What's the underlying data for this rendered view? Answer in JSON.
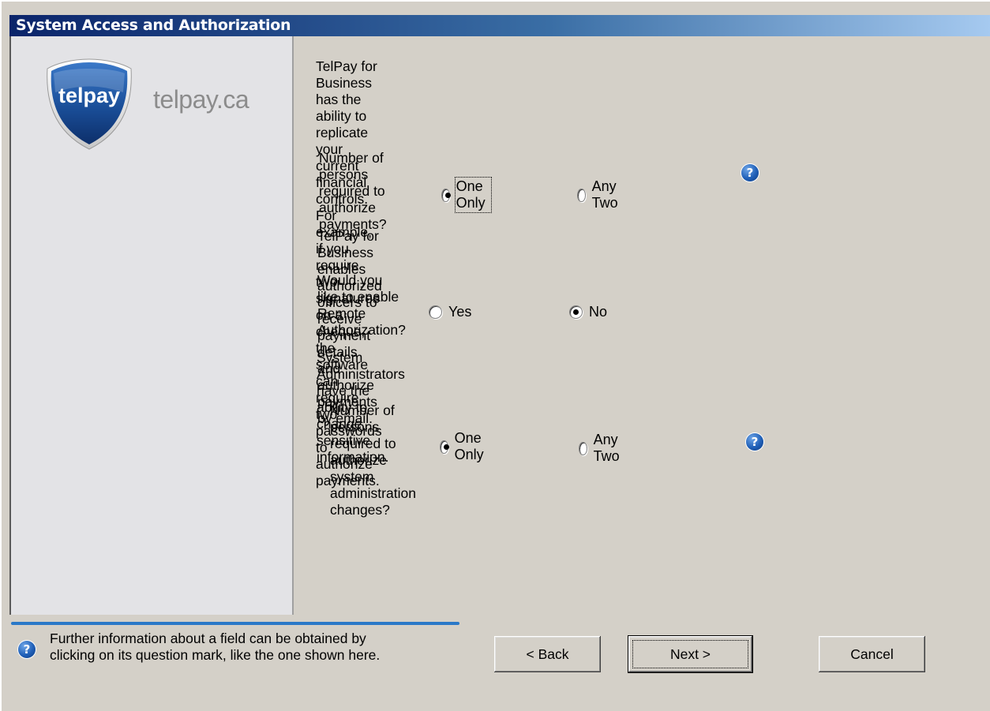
{
  "window": {
    "title": "System Access and Authorization"
  },
  "brand": {
    "shield_text": "telpay",
    "site_text": "telpay.ca"
  },
  "intro": {
    "line1": "TelPay for Business has the ability to replicate your current financial controls. For",
    "line2": "example, if you require two signatures on a cheque, the software can require two",
    "line3": "passwords to authorize payments."
  },
  "payments_auth": {
    "question": "Number of persons required to authorize payments?",
    "options": [
      {
        "label": "One Only",
        "checked": true
      },
      {
        "label": "Any Two",
        "checked": false
      }
    ]
  },
  "remote_auth": {
    "line1": "TelPay for Business enables authorized officers to receive payment details and",
    "line2": "authorize payments by email.",
    "question": "Would you like to enable Remote Authorization?",
    "options": [
      {
        "label": "Yes",
        "checked": false
      },
      {
        "label": "No",
        "checked": true
      }
    ]
  },
  "admin_auth": {
    "info": "System Administrators have the ability to change sensitive information.",
    "question": "Number of persons required to authorize system administration changes?",
    "options": [
      {
        "label": "One Only",
        "checked": true
      },
      {
        "label": "Any Two",
        "checked": false
      }
    ]
  },
  "footer": {
    "help_line1": "Further information about a field can be obtained by",
    "help_line2": "clicking on its question mark, like the one shown here.",
    "back_label": "< Back",
    "next_label": "Next >",
    "cancel_label": "Cancel"
  },
  "icons": {
    "help": "question-mark-icon"
  },
  "colors": {
    "title_start": "#0a246a",
    "title_end": "#a6caf0",
    "brand_blue": "#1e5aa8",
    "help_blue": "#2060b8",
    "footer_line": "#2a79c8"
  }
}
